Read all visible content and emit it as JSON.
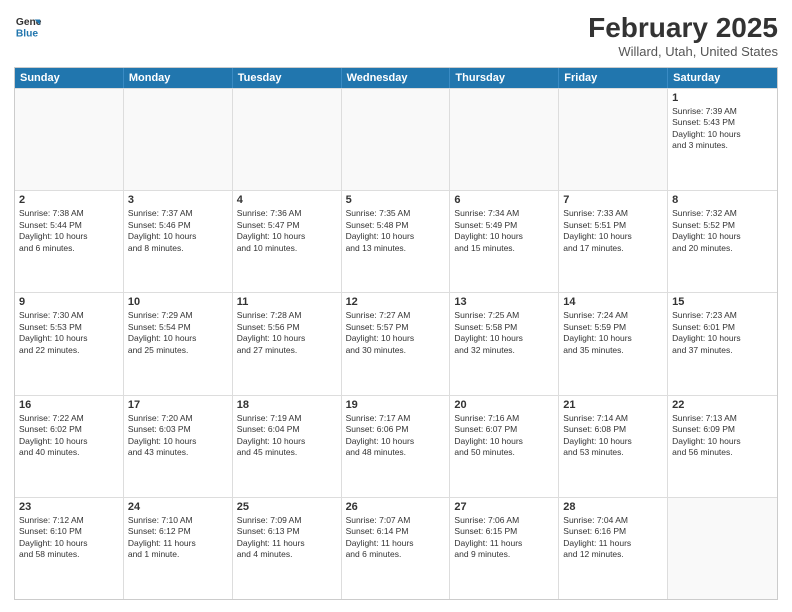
{
  "header": {
    "logo_line1": "General",
    "logo_line2": "Blue",
    "month_year": "February 2025",
    "location": "Willard, Utah, United States"
  },
  "weekdays": [
    "Sunday",
    "Monday",
    "Tuesday",
    "Wednesday",
    "Thursday",
    "Friday",
    "Saturday"
  ],
  "weeks": [
    [
      {
        "day": "",
        "text": ""
      },
      {
        "day": "",
        "text": ""
      },
      {
        "day": "",
        "text": ""
      },
      {
        "day": "",
        "text": ""
      },
      {
        "day": "",
        "text": ""
      },
      {
        "day": "",
        "text": ""
      },
      {
        "day": "1",
        "text": "Sunrise: 7:39 AM\nSunset: 5:43 PM\nDaylight: 10 hours\nand 3 minutes."
      }
    ],
    [
      {
        "day": "2",
        "text": "Sunrise: 7:38 AM\nSunset: 5:44 PM\nDaylight: 10 hours\nand 6 minutes."
      },
      {
        "day": "3",
        "text": "Sunrise: 7:37 AM\nSunset: 5:46 PM\nDaylight: 10 hours\nand 8 minutes."
      },
      {
        "day": "4",
        "text": "Sunrise: 7:36 AM\nSunset: 5:47 PM\nDaylight: 10 hours\nand 10 minutes."
      },
      {
        "day": "5",
        "text": "Sunrise: 7:35 AM\nSunset: 5:48 PM\nDaylight: 10 hours\nand 13 minutes."
      },
      {
        "day": "6",
        "text": "Sunrise: 7:34 AM\nSunset: 5:49 PM\nDaylight: 10 hours\nand 15 minutes."
      },
      {
        "day": "7",
        "text": "Sunrise: 7:33 AM\nSunset: 5:51 PM\nDaylight: 10 hours\nand 17 minutes."
      },
      {
        "day": "8",
        "text": "Sunrise: 7:32 AM\nSunset: 5:52 PM\nDaylight: 10 hours\nand 20 minutes."
      }
    ],
    [
      {
        "day": "9",
        "text": "Sunrise: 7:30 AM\nSunset: 5:53 PM\nDaylight: 10 hours\nand 22 minutes."
      },
      {
        "day": "10",
        "text": "Sunrise: 7:29 AM\nSunset: 5:54 PM\nDaylight: 10 hours\nand 25 minutes."
      },
      {
        "day": "11",
        "text": "Sunrise: 7:28 AM\nSunset: 5:56 PM\nDaylight: 10 hours\nand 27 minutes."
      },
      {
        "day": "12",
        "text": "Sunrise: 7:27 AM\nSunset: 5:57 PM\nDaylight: 10 hours\nand 30 minutes."
      },
      {
        "day": "13",
        "text": "Sunrise: 7:25 AM\nSunset: 5:58 PM\nDaylight: 10 hours\nand 32 minutes."
      },
      {
        "day": "14",
        "text": "Sunrise: 7:24 AM\nSunset: 5:59 PM\nDaylight: 10 hours\nand 35 minutes."
      },
      {
        "day": "15",
        "text": "Sunrise: 7:23 AM\nSunset: 6:01 PM\nDaylight: 10 hours\nand 37 minutes."
      }
    ],
    [
      {
        "day": "16",
        "text": "Sunrise: 7:22 AM\nSunset: 6:02 PM\nDaylight: 10 hours\nand 40 minutes."
      },
      {
        "day": "17",
        "text": "Sunrise: 7:20 AM\nSunset: 6:03 PM\nDaylight: 10 hours\nand 43 minutes."
      },
      {
        "day": "18",
        "text": "Sunrise: 7:19 AM\nSunset: 6:04 PM\nDaylight: 10 hours\nand 45 minutes."
      },
      {
        "day": "19",
        "text": "Sunrise: 7:17 AM\nSunset: 6:06 PM\nDaylight: 10 hours\nand 48 minutes."
      },
      {
        "day": "20",
        "text": "Sunrise: 7:16 AM\nSunset: 6:07 PM\nDaylight: 10 hours\nand 50 minutes."
      },
      {
        "day": "21",
        "text": "Sunrise: 7:14 AM\nSunset: 6:08 PM\nDaylight: 10 hours\nand 53 minutes."
      },
      {
        "day": "22",
        "text": "Sunrise: 7:13 AM\nSunset: 6:09 PM\nDaylight: 10 hours\nand 56 minutes."
      }
    ],
    [
      {
        "day": "23",
        "text": "Sunrise: 7:12 AM\nSunset: 6:10 PM\nDaylight: 10 hours\nand 58 minutes."
      },
      {
        "day": "24",
        "text": "Sunrise: 7:10 AM\nSunset: 6:12 PM\nDaylight: 11 hours\nand 1 minute."
      },
      {
        "day": "25",
        "text": "Sunrise: 7:09 AM\nSunset: 6:13 PM\nDaylight: 11 hours\nand 4 minutes."
      },
      {
        "day": "26",
        "text": "Sunrise: 7:07 AM\nSunset: 6:14 PM\nDaylight: 11 hours\nand 6 minutes."
      },
      {
        "day": "27",
        "text": "Sunrise: 7:06 AM\nSunset: 6:15 PM\nDaylight: 11 hours\nand 9 minutes."
      },
      {
        "day": "28",
        "text": "Sunrise: 7:04 AM\nSunset: 6:16 PM\nDaylight: 11 hours\nand 12 minutes."
      },
      {
        "day": "",
        "text": ""
      }
    ]
  ]
}
